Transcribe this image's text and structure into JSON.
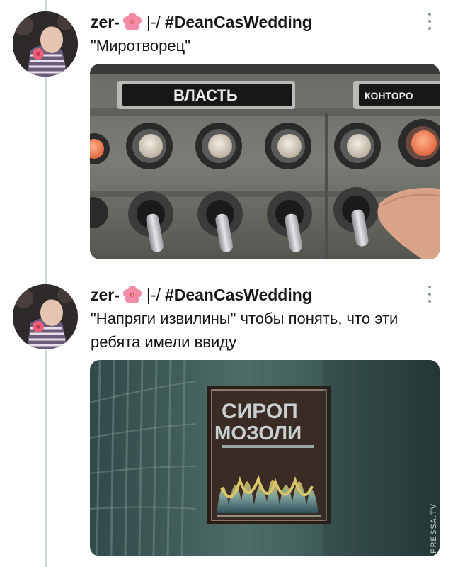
{
  "tweets": [
    {
      "author": {
        "name_prefix": "zer-",
        "separator": "|-/",
        "hashtag": "#DeanCasWedding",
        "flower_icon": "hibiscus-icon"
      },
      "text": "\"Миротворец\"",
      "media": {
        "panel_label_left": "ВЛАСТЬ",
        "panel_label_right": "КОНТОРО"
      }
    },
    {
      "author": {
        "name_prefix": "zer-",
        "separator": "|-/",
        "hashtag": "#DeanCasWedding",
        "flower_icon": "hibiscus-icon"
      },
      "text": "\"Напряги извилины\" чтобы понять, что эти ребята имели ввиду",
      "media": {
        "sign_line1": "СИРОП",
        "sign_line2": "МОЗОЛИ",
        "watermark": "PRESSA.TV"
      }
    }
  ],
  "colors": {
    "thread_line": "#cfd9de",
    "text": "#14171a",
    "more_dots": "#8899a6",
    "flower": "#f28ca6"
  }
}
